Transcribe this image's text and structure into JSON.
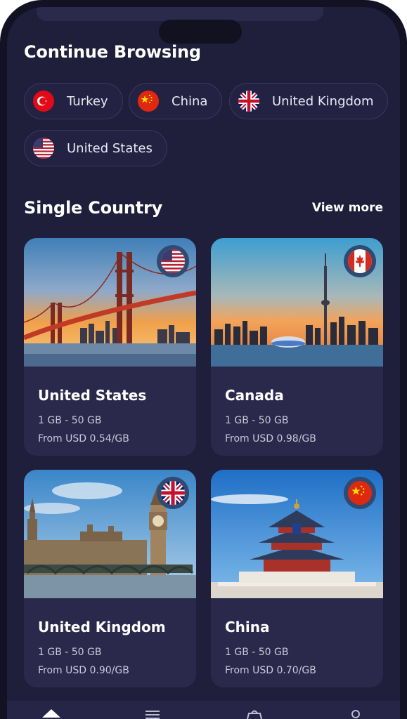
{
  "continue_browsing": {
    "title": "Continue Browsing",
    "chips": [
      {
        "label": "Turkey",
        "flag": "turkey-flag"
      },
      {
        "label": "China",
        "flag": "china-flag"
      },
      {
        "label": "United Kingdom",
        "flag": "uk-flag"
      },
      {
        "label": "United States",
        "flag": "us-flag"
      }
    ]
  },
  "single_country": {
    "title": "Single Country",
    "view_more": "View more",
    "cards": [
      {
        "name": "United States",
        "range": "1 GB - 50 GB",
        "price": "From USD 0.54/GB",
        "photo": "golden-gate-bridge",
        "flag": "us-flag"
      },
      {
        "name": "Canada",
        "range": "1 GB - 50 GB",
        "price": "From USD 0.98/GB",
        "photo": "toronto-skyline",
        "flag": "canada-flag"
      },
      {
        "name": "United Kingdom",
        "range": "1 GB - 50 GB",
        "price": "From USD 0.90/GB",
        "photo": "big-ben-london",
        "flag": "uk-flag"
      },
      {
        "name": "China",
        "range": "1 GB - 50 GB",
        "price": "From USD 0.70/GB",
        "photo": "temple-of-heaven",
        "flag": "china-flag"
      }
    ]
  },
  "bottom_nav": {
    "icons": [
      "home-icon",
      "list-icon",
      "shop-icon",
      "profile-icon"
    ]
  },
  "colors": {
    "background": "#1f1e3b",
    "card": "#2a294b",
    "chip": "#232243",
    "text": "#ffffff"
  }
}
